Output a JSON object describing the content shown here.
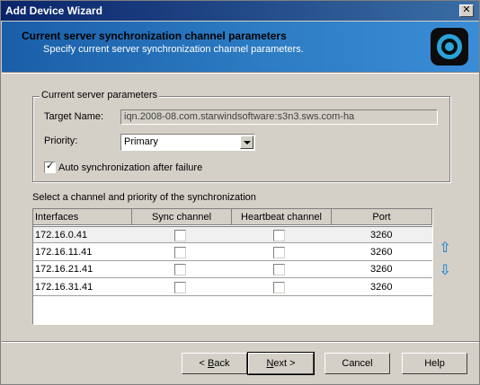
{
  "window": {
    "title": "Add Device Wizard",
    "close_glyph": "✕"
  },
  "header": {
    "title": "Current server synchronization channel parameters",
    "subtitle": "Specify current server synchronization channel parameters.",
    "logo_icon": "starwind-logo-icon"
  },
  "group": {
    "legend": "Current server parameters",
    "target_label": "Target Name:",
    "target_value": "iqn.2008-08.com.starwindsoftware:s3n3.sws.com-ha",
    "priority_label": "Priority:",
    "priority_value": "Primary",
    "auto_sync_label": "Auto synchronization after failure",
    "auto_sync_checked": true
  },
  "channels": {
    "caption": "Select a channel and priority of the synchronization",
    "columns": [
      "Interfaces",
      "Sync channel",
      "Heartbeat channel",
      "Port"
    ],
    "rows": [
      {
        "interface": "172.16.0.41",
        "sync": false,
        "heartbeat": false,
        "port": "3260"
      },
      {
        "interface": "172.16.11.41",
        "sync": false,
        "heartbeat": false,
        "port": "3260"
      },
      {
        "interface": "172.16.21.41",
        "sync": false,
        "heartbeat": false,
        "port": "3260"
      },
      {
        "interface": "172.16.31.41",
        "sync": false,
        "heartbeat": false,
        "port": "3260"
      }
    ],
    "move_up_icon": "arrow-up-icon",
    "move_down_icon": "arrow-down-icon"
  },
  "buttons": {
    "back": {
      "prefix": "< ",
      "mnemonic": "B",
      "rest": "ack"
    },
    "next": {
      "mnemonic": "N",
      "rest": "ext >"
    },
    "cancel": "Cancel",
    "help": "Help"
  },
  "colors": {
    "header_bg": "#2d7cc4",
    "accent_blue": "#3a8fd0",
    "titlebar": "#0a246a"
  }
}
